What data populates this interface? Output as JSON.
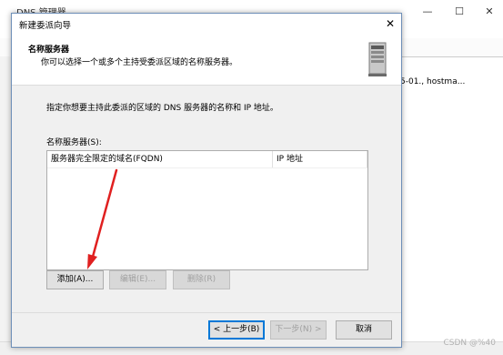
{
  "background_app": {
    "title": "DNS 管理器",
    "soa_text": "5-01., hostma...",
    "watermark": "CSDN @%40"
  },
  "dialog": {
    "title": "新建委派向导",
    "header_title": "名称服务器",
    "header_subtitle": "你可以选择一个或多个主持受委派区域的名称服务器。",
    "instruction": "指定你想要主持此委派的区域的 DNS 服务器的名称和 IP 地址。",
    "list_label": "名称服务器(S):",
    "columns": [
      "服务器完全限定的域名(FQDN)",
      "IP 地址"
    ],
    "rows": [],
    "buttons": {
      "add": "添加(A)...",
      "edit": "编辑(E)...",
      "delete": "删除(R)",
      "back": "< 上一步(B)",
      "next": "下一步(N) >",
      "cancel": "取消"
    },
    "close_glyph": "✕"
  },
  "colors": {
    "annotation_arrow": "#e02020",
    "accent": "#0078d7"
  },
  "icons": [
    "server-icon",
    "close-icon",
    "minimize-icon",
    "maximize-icon",
    "app-icon"
  ]
}
